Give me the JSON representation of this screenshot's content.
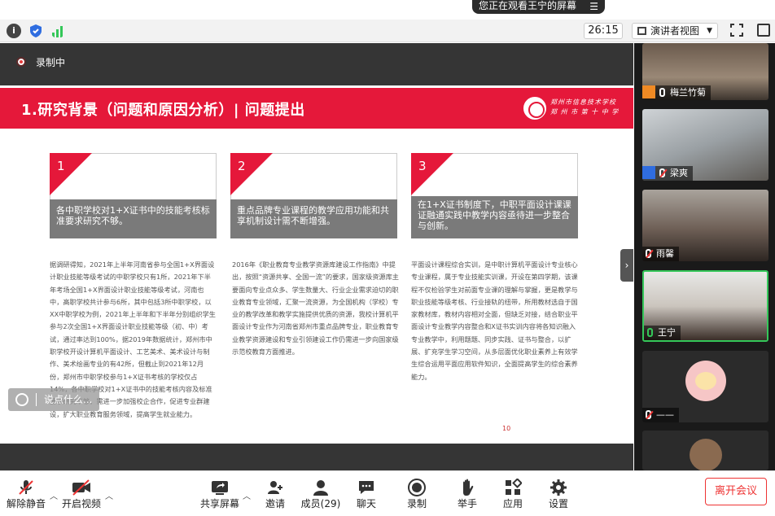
{
  "share_banner": {
    "text": "您正在观看王宁的屏幕"
  },
  "toolbar": {
    "timer": "26:15",
    "view_label": "演讲者视图"
  },
  "recording": {
    "label": "录制中"
  },
  "slide": {
    "title": "1.研究背景（问题和原因分析）|  问题提出",
    "logo_lines": [
      "郑州市信息技术学校",
      "郑 州 市 第 十 中 学"
    ],
    "cards": [
      {
        "num": "1",
        "text": "各中职学校对1+X证书中的技能考核标准要求研究不够。"
      },
      {
        "num": "2",
        "text": "重点品牌专业课程的教学应用功能和共享机制设计需不断增强。"
      },
      {
        "num": "3",
        "text": "在1+X证书制度下，中职平面设计课课证融通实践中教学内容亟待进一步整合与创新。"
      }
    ],
    "paragraphs": [
      "据调研得知，2021年上半年河南省参与全国1+X界面设计职业技能等级考试的中职学校只有1所，2021年下半年考场全国1+X界面设计职业技能等级考试，河南也中，高职学校共计参与6所，其中包括3所中职学校，以XX中职学校为例，2021年上半年和下半年分别组织学生参与2次全国1+X界面设计职业技能等级（初、中）考试，通过率达到100%，据2019年数据统计，郑州市中职学校开设计算机平面设计、工艺美术、美术设计与制作、美术绘画专业的有42所，但截止到2021年12月份，郑州市中职学校参与1+X证书考核的学校仅占14%，各中职学校对1+X证书中的技能考核内容及标准要求研究不够，需进一步加强校企合作，促进专业群建设，扩大职业教育服务领域，提高学生就业能力。",
      "2016年《职业教育专业教学资源库建设工作指南》中提出，按照“资源共享、全国一流”的要求，国家级资源库主要面向专业点众多、学生数量大、行业企业需求迫切的职业教育专业领域，汇聚一流资源，为全国机构（学校）专业的教学改革和教学实施提供优质的资源，我校计算机平面设计专业作为河南省郑州市重点品牌专业，职业教育专业教学资源建设和专业引领建设工作仍需进一步向国家级示范校教育方面推进。",
      "平面设计课程综合实训，是中职计算机平面设计专业核心专业课程，属于专业技能实训课，开设在第四学期，该课程不仅检验学生对前面专业课的理解与掌握，更是教学与职业技能等级考核、行业接轨的纽带，所用教材选自于国家教材库，教材内容相对全面，但缺乏对接，结合职业平面设计专业教学内容整合和X证书实训内容将各知识融入专业教学中，利用题题、同步实践、证书与整合，以扩展、扩充学生学习空间，从多层面优化职业素养上有效学生综合运用平面应用软件知识，全面提高学生的综合素养能力。"
    ],
    "page_mark": "10"
  },
  "say_box": {
    "placeholder": "说点什么..."
  },
  "participants": [
    {
      "name": "梅兰竹菊",
      "badge": "host",
      "mic": "on"
    },
    {
      "name": "梁爽",
      "badge": "cohost",
      "mic": "muted"
    },
    {
      "name": "雨馨",
      "badge": "",
      "mic": "muted"
    },
    {
      "name": "王宁",
      "badge": "",
      "mic": "on"
    },
    {
      "name": "——",
      "badge": "",
      "mic": "muted"
    },
    {
      "name": "",
      "badge": "",
      "mic": ""
    }
  ],
  "bottom_bar": {
    "mute": "解除静音",
    "video": "开启视频",
    "share": "共享屏幕",
    "invite": "邀请",
    "members": "成员(29)",
    "chat": "聊天",
    "record": "录制",
    "raise": "举手",
    "apps": "应用",
    "settings": "设置",
    "leave": "离开会议"
  },
  "colors": {
    "accent_red": "#e5183a",
    "active_green": "#34c759"
  }
}
